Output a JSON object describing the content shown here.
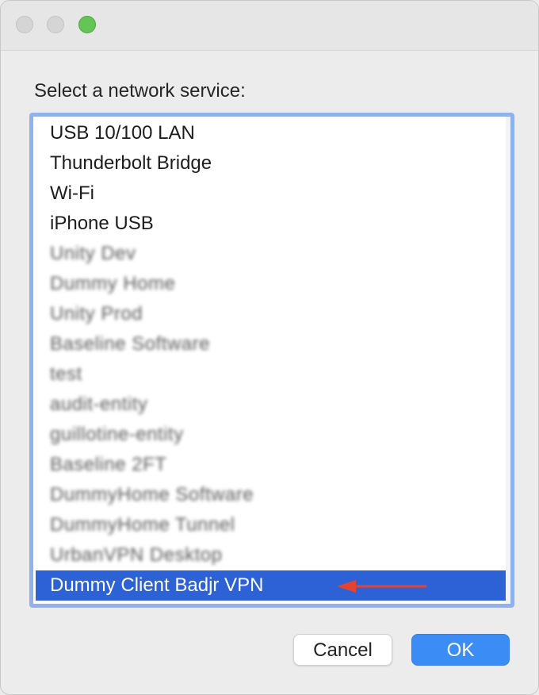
{
  "window": {
    "controls": {
      "close": "close-icon",
      "minimize": "minimize-icon",
      "zoom": "zoom-icon"
    }
  },
  "dialog": {
    "prompt": "Select a network service:",
    "services": [
      {
        "label": "USB 10/100 LAN",
        "obscured": false
      },
      {
        "label": "Thunderbolt Bridge",
        "obscured": false
      },
      {
        "label": "Wi-Fi",
        "obscured": false
      },
      {
        "label": "iPhone USB",
        "obscured": false
      },
      {
        "label": "Unity Dev",
        "obscured": true
      },
      {
        "label": "Dummy Home",
        "obscured": true
      },
      {
        "label": "Unity Prod",
        "obscured": true
      },
      {
        "label": "Baseline Software",
        "obscured": true
      },
      {
        "label": "test",
        "obscured": true
      },
      {
        "label": "audit-entity",
        "obscured": true
      },
      {
        "label": "guillotine-entity",
        "obscured": true
      },
      {
        "label": "Baseline 2FT",
        "obscured": true
      },
      {
        "label": "DummyHome Software",
        "obscured": true
      },
      {
        "label": "DummyHome Tunnel",
        "obscured": true
      },
      {
        "label": "UrbanVPN Desktop",
        "obscured": true
      },
      {
        "label": "Dummy Client Badjr VPN",
        "obscured": false,
        "selected": true
      }
    ],
    "selected_color": "#2c62d6",
    "focus_ring_color": "#8fb1ef",
    "annotation_arrow_color": "#e4432f",
    "buttons": {
      "cancel": "Cancel",
      "ok": "OK"
    },
    "ok_color": "#3b8df5"
  }
}
